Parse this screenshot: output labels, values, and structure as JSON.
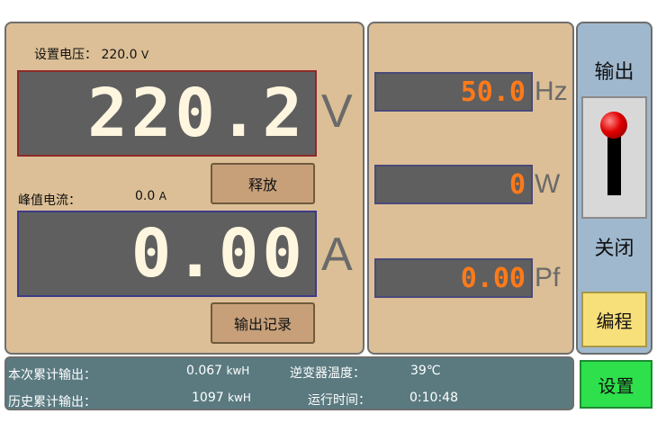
{
  "voltage": {
    "set_label": "设置电压：",
    "set_value": "220.0",
    "set_unit": "V",
    "reading": "220.2",
    "unit": "V"
  },
  "current": {
    "peak_label": "峰值电流：",
    "peak_value": "0.0",
    "peak_unit": "A",
    "reading": "0.00",
    "unit": "A"
  },
  "buttons": {
    "release": "释放",
    "output_log": "输出记录",
    "program": "编程",
    "settings": "设置"
  },
  "meters": [
    {
      "value": "50.0",
      "unit": "Hz"
    },
    {
      "value": "0",
      "unit": "W"
    },
    {
      "value": "0.00",
      "unit": "Pf"
    }
  ],
  "output_switch": {
    "title": "输出",
    "state": "关闭"
  },
  "stats": {
    "session_output_label": "本次累计输出：",
    "session_output_value": "0.067",
    "session_output_unit": "kwH",
    "history_output_label": "历史累计输出：",
    "history_output_value": "1097",
    "history_output_unit": "kwH",
    "inverter_temp_label": "逆变器温度：",
    "inverter_temp_value": "39℃",
    "runtime_label": "运行时间：",
    "runtime_value": "0:10:48"
  },
  "colors": {
    "panel_bg": "#dcbf96",
    "lcd_bg": "#5f5f5f",
    "digit_orange": "#ff7a1a",
    "program_yellow": "#f7df7a",
    "settings_green": "#2de04c"
  }
}
